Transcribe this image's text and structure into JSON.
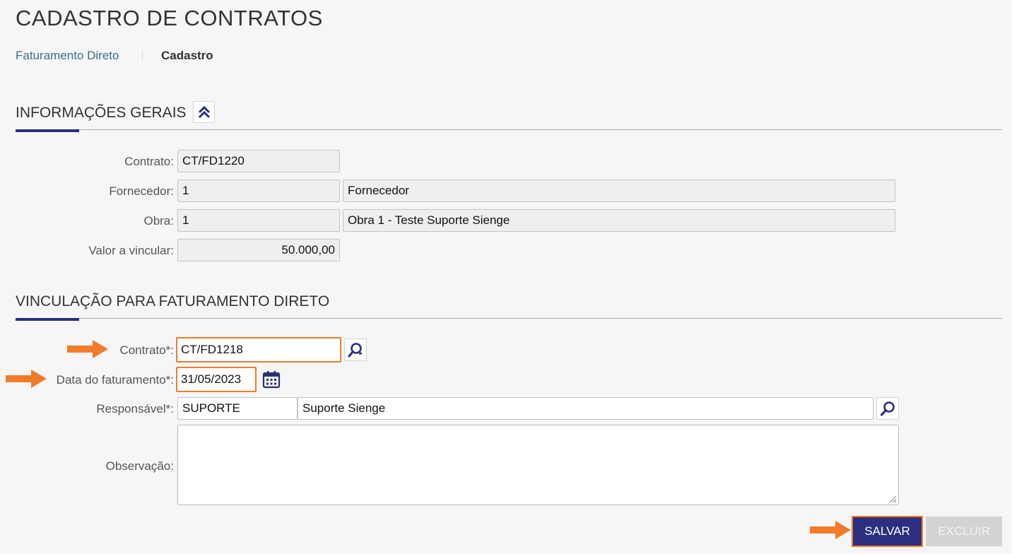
{
  "page": {
    "title": "CADASTRO DE CONTRATOS",
    "breadcrumb": {
      "link": "Faturamento Direto",
      "current": "Cadastro"
    }
  },
  "colors": {
    "accent": "#2c2f7d",
    "highlight": "#f27b2a",
    "link": "#3d6c8c"
  },
  "general": {
    "title": "INFORMAÇÕES GERAIS",
    "collapse_icon": "double-chevron-up-icon",
    "contrato": {
      "label": "Contrato:",
      "value": "CT/FD1220"
    },
    "fornecedor": {
      "label": "Fornecedor:",
      "code": "1",
      "name": "Fornecedor"
    },
    "obra": {
      "label": "Obra:",
      "code": "1",
      "name": "Obra 1 - Teste Suporte Sienge"
    },
    "valor": {
      "label": "Valor a vincular:",
      "value": "50.000,00"
    }
  },
  "link": {
    "title": "VINCULAÇÃO PARA FATURAMENTO DIRETO",
    "contrato": {
      "label": "Contrato*:",
      "value": "CT/FD1218",
      "icon": "search-refresh-icon"
    },
    "data": {
      "label": "Data do faturamento*:",
      "value": "31/05/2023",
      "icon": "calendar-icon"
    },
    "responsavel": {
      "label": "Responsável*:",
      "code": "SUPORTE",
      "name": "Suporte Sienge",
      "icon": "search-icon"
    },
    "observacao": {
      "label": "Observação:",
      "value": ""
    }
  },
  "actions": {
    "save_label": "SALVAR",
    "delete_label": "EXCLUIR"
  }
}
